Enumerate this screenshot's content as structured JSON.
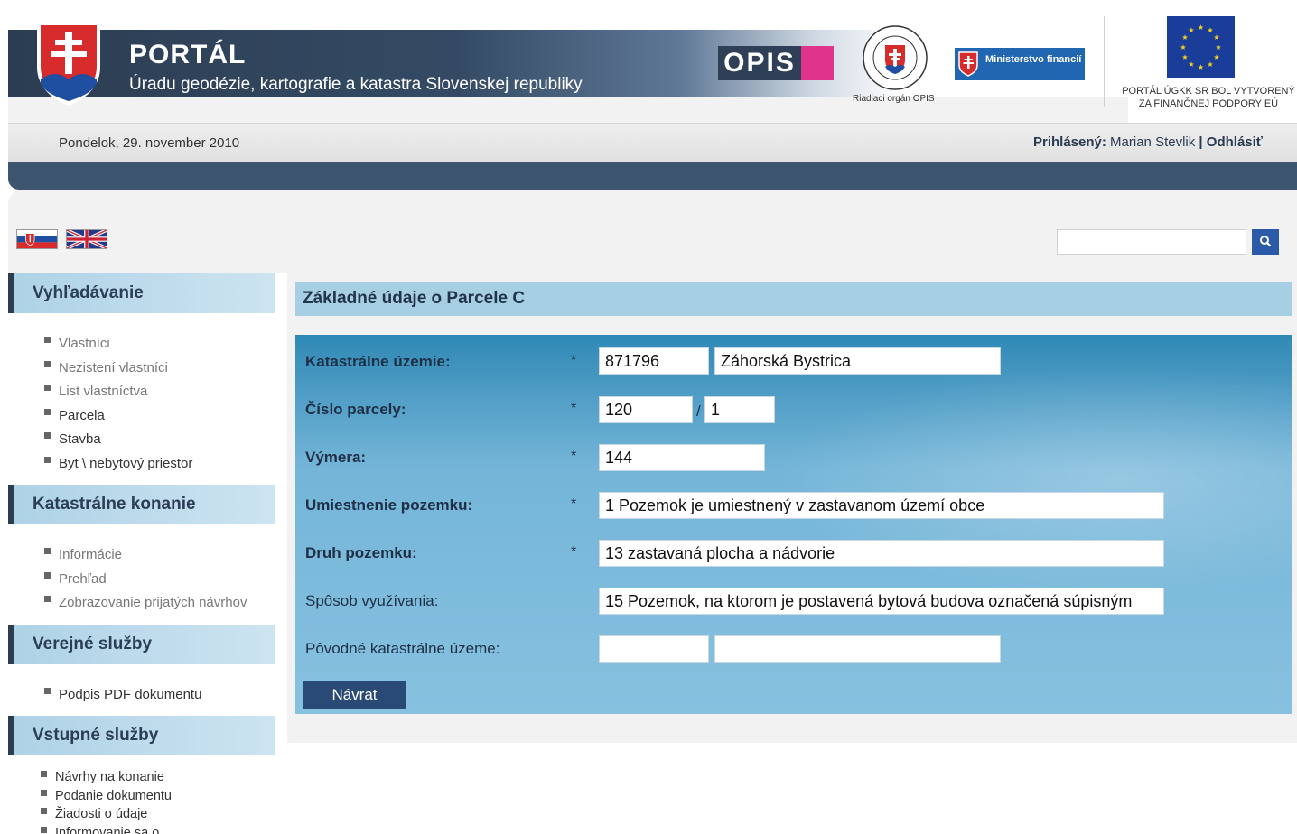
{
  "header": {
    "title": "PORTÁL",
    "subtitle": "Úradu geodézie, kartografie a katastra Slovenskej republiky",
    "opis_logo_text": "OPIS",
    "seal_caption": "Riadiaci orgán OPIS",
    "mf_logo_text": "Ministerstvo financií",
    "eu_caption_line1": "PORTÁL ÚGKK SR BOL VYTVORENÝ",
    "eu_caption_line2": "ZA FINANČNEJ PODPORY EÚ"
  },
  "infobar": {
    "date": "Pondelok, 29. november 2010",
    "logged_label": "Prihlásený:",
    "user_name": "Marian Stevlik",
    "separator": "|",
    "logout": "Odhlásiť"
  },
  "search": {
    "value": ""
  },
  "sidebar": {
    "sections": [
      {
        "title": "Vyhľadávanie",
        "items": [
          "Vlastníci",
          "Nezistení vlastníci",
          "List vlastníctva",
          "Parcela",
          "Stavba",
          "Byt \\ nebytový priestor"
        ]
      },
      {
        "title": "Katastrálne konanie",
        "items": [
          "Informácie",
          "Prehľad",
          "Zobrazovanie prijatých návrhov"
        ]
      },
      {
        "title": "Verejné služby",
        "items": [
          "Podpis PDF dokumentu"
        ]
      },
      {
        "title": "Vstupné služby",
        "items": [
          "Návrhy na konanie",
          "Podanie dokumentu",
          "Žiadosti o údaje",
          "Informovanie sa o ..."
        ]
      }
    ]
  },
  "main": {
    "title": "Základné údaje o Parcele C",
    "fields": {
      "kat_uzemie_label": "Katastrálne územie:",
      "kat_uzemie_code": "871796",
      "kat_uzemie_name": "Záhorská Bystrica",
      "cislo_parcely_label": "Číslo parcely:",
      "cislo_parcely_main": "120",
      "cislo_parcely_slash": "/",
      "cislo_parcely_sub": "1",
      "vymera_label": "Výmera:",
      "vymera_value": "144",
      "umiestnenie_label": "Umiestnenie pozemku:",
      "umiestnenie_value": "1 Pozemok je umiestnený v zastavanom území obce",
      "druh_label": "Druh pozemku:",
      "druh_value": "13 zastavaná plocha a nádvorie",
      "sposob_label": "Spôsob využívania:",
      "sposob_value": "15 Pozemok, na ktorom je postavená bytová budova označená súpisným",
      "povodne_label": "Pôvodné katastrálne územe:",
      "povodne_code": "",
      "povodne_name": "",
      "required_mark": "*"
    },
    "back_button": "Návrat"
  },
  "colors": {
    "banner_dark": "#2c3d52",
    "sidebar_header": "#aed2e6",
    "content_title_bg": "#a6cfe4",
    "form_panel": "#74b5d8",
    "button": "#2a4a76",
    "search_button": "#2a5aa8"
  },
  "icons": {
    "crest": "slovak-coat-of-arms-icon",
    "search": "search-icon",
    "flag_sk": "flag-sk-icon",
    "flag_uk": "flag-uk-icon",
    "eu_flag": "eu-flag-icon"
  }
}
